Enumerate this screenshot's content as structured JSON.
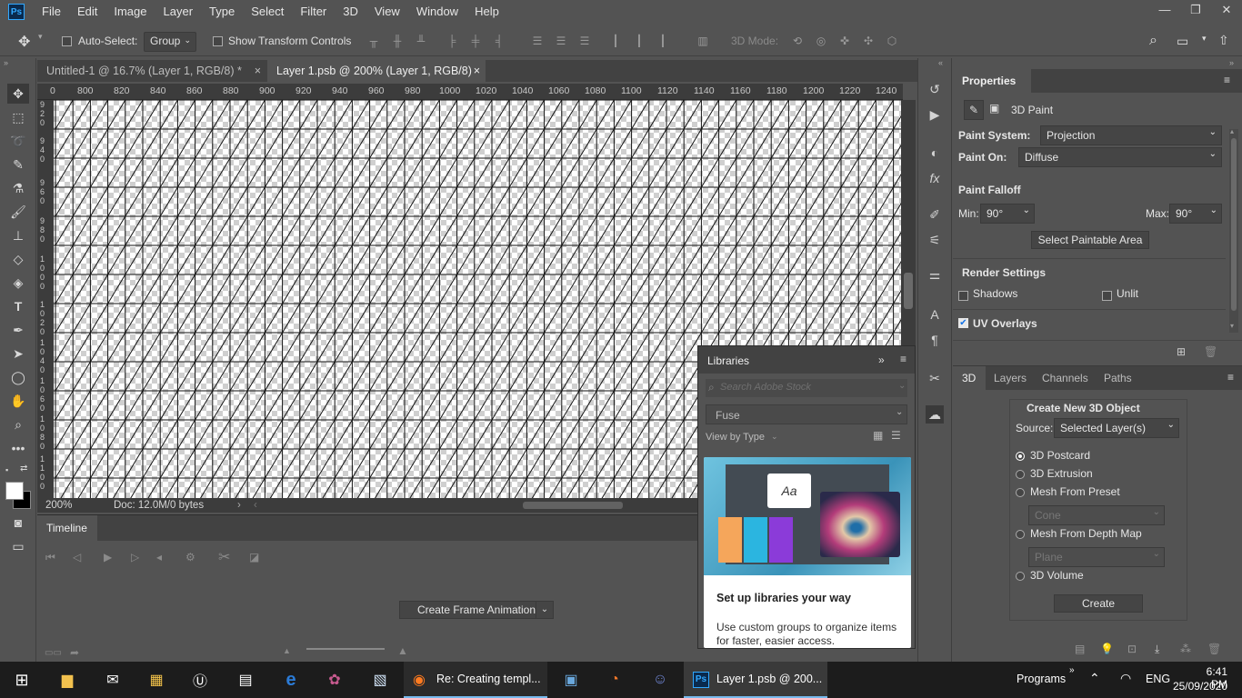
{
  "app": {
    "logo": "Ps"
  },
  "menu": [
    "File",
    "Edit",
    "Image",
    "Layer",
    "Type",
    "Select",
    "Filter",
    "3D",
    "View",
    "Window",
    "Help"
  ],
  "window_controls": {
    "minimize": "—",
    "restore": "❐",
    "close": "✕"
  },
  "options": {
    "auto_select_label": "Auto-Select:",
    "group_value": "Group",
    "show_transform_label": "Show Transform Controls",
    "mode3d_label": "3D Mode:"
  },
  "tabs": [
    {
      "label": "Untitled-1 @ 16.7% (Layer 1, RGB/8) *",
      "close": "×"
    },
    {
      "label": "Layer 1.psb @ 200% (Layer 1, RGB/8)",
      "close": "×"
    }
  ],
  "ruler": {
    "top": [
      "0",
      "800",
      "820",
      "840",
      "860",
      "880",
      "900",
      "920",
      "940",
      "960",
      "980",
      "1000",
      "1020",
      "1040",
      "1060",
      "1080",
      "1100",
      "1120",
      "1140",
      "1160",
      "1180",
      "1200",
      "1220",
      "1240"
    ],
    "left": [
      "9 2 0",
      "9 4 0",
      "9 6 0",
      "9 8 0",
      "1 0 0 0",
      "1 0 2 0",
      "1 0 4 0",
      "1 0 6 0",
      "1 0 8 0",
      "1 1 0 0"
    ]
  },
  "status": {
    "zoom": "200%",
    "doc": "Doc: 12.0M/0 bytes"
  },
  "timeline": {
    "title": "Timeline",
    "create_button": "Create Frame Animation"
  },
  "libraries": {
    "title": "Libraries",
    "search_placeholder": "Search Adobe Stock",
    "library_select": "Fuse",
    "view_by": "View by Type",
    "card_title": "Set up libraries your way",
    "card_text": "Use custom groups to organize items for faster, easier access.",
    "card_aa": "Aa"
  },
  "properties": {
    "title": "Properties",
    "subtitle": "3D Paint",
    "paint_system_label": "Paint System:",
    "paint_system_value": "Projection",
    "paint_on_label": "Paint On:",
    "paint_on_value": "Diffuse",
    "falloff_label": "Paint Falloff",
    "min_label": "Min:",
    "min_value": "90°",
    "max_label": "Max:",
    "max_value": "90°",
    "select_area_button": "Select Paintable Area",
    "render_label": "Render Settings",
    "shadows_label": "Shadows",
    "unlit_label": "Unlit",
    "uv_label": "UV Overlays"
  },
  "panel3d": {
    "tabs": [
      "3D",
      "Layers",
      "Channels",
      "Paths"
    ],
    "heading": "Create New 3D Object",
    "source_label": "Source:",
    "source_value": "Selected Layer(s)",
    "options": [
      "3D Postcard",
      "3D Extrusion",
      "Mesh From Preset",
      "Mesh From Depth Map",
      "3D Volume"
    ],
    "preset_value": "Cone",
    "depth_value": "Plane",
    "create_button": "Create"
  },
  "taskbar": {
    "firefox_label": "Re: Creating templ...",
    "ps_label": "Layer 1.psb @ 200...",
    "programs": "Programs",
    "lang": "ENG",
    "time": "6:41 PM",
    "date": "25/09/2020"
  },
  "colors": {
    "ps_blue": "#31a8ff",
    "panel": "#535353",
    "dark": "#3c3c3c",
    "taskbar": "#1c1c1c"
  }
}
